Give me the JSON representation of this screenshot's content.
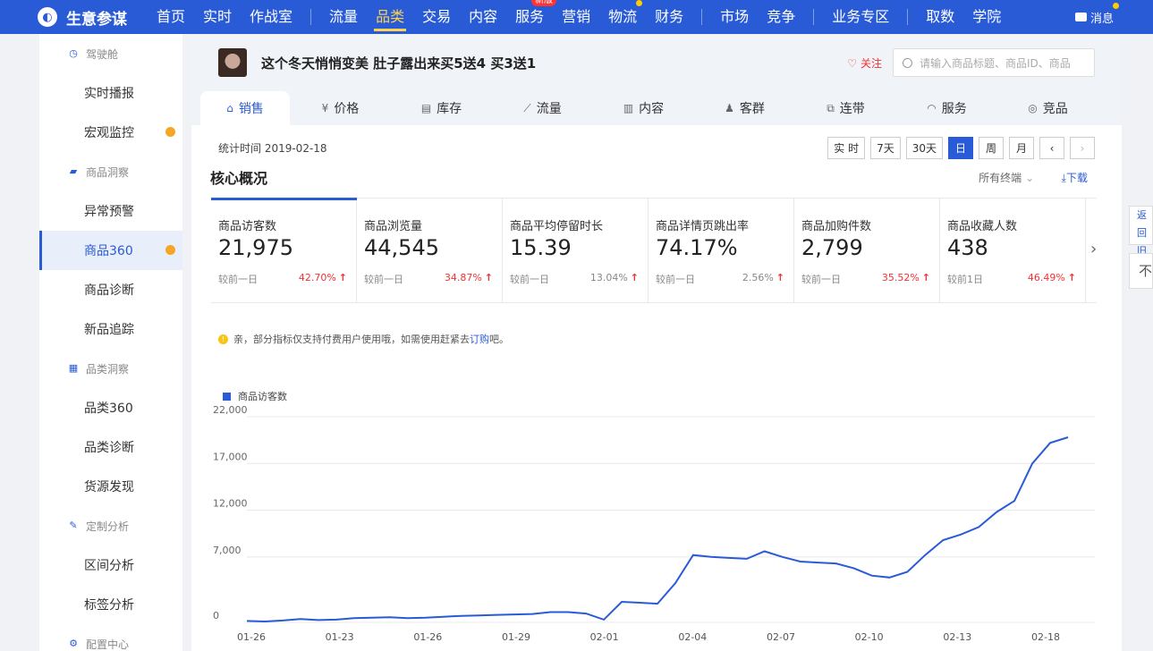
{
  "app": {
    "title": "生意参谋",
    "logo_icon": "compass-icon"
  },
  "nav": {
    "items": [
      {
        "label": "首页"
      },
      {
        "label": "实时"
      },
      {
        "label": "作战室"
      },
      {
        "label": "流量"
      },
      {
        "label": "品类",
        "active": true
      },
      {
        "label": "交易"
      },
      {
        "label": "内容"
      },
      {
        "label": "服务",
        "badge": "新版"
      },
      {
        "label": "营销"
      },
      {
        "label": "物流",
        "dot": true
      },
      {
        "label": "财务"
      },
      {
        "label": "市场"
      },
      {
        "label": "竞争"
      },
      {
        "label": "业务专区"
      },
      {
        "label": "取数"
      },
      {
        "label": "学院"
      }
    ],
    "message_label": "消息"
  },
  "sidebar": {
    "groups": [
      {
        "label": "驾驶舱",
        "icon": "dashboard-icon",
        "items": [
          {
            "label": "实时播报"
          },
          {
            "label": "宏观监控",
            "dot": true
          }
        ]
      },
      {
        "label": "商品洞察",
        "icon": "bag-icon",
        "items": [
          {
            "label": "异常预警"
          },
          {
            "label": "商品360",
            "dot": true,
            "active": true
          },
          {
            "label": "商品诊断"
          },
          {
            "label": "新品追踪"
          }
        ]
      },
      {
        "label": "品类洞察",
        "icon": "grid-icon",
        "items": [
          {
            "label": "品类360"
          },
          {
            "label": "品类诊断"
          },
          {
            "label": "货源发现"
          }
        ]
      },
      {
        "label": "定制分析",
        "icon": "wrench-icon",
        "items": [
          {
            "label": "区间分析"
          },
          {
            "label": "标签分析"
          }
        ]
      },
      {
        "label": "配置中心",
        "icon": "gear-icon",
        "items": []
      }
    ]
  },
  "product": {
    "title": "这个冬天悄悄变美 肚子露出来买5送4 买3送1",
    "follow_label": "关注",
    "search_placeholder": "请输入商品标题、商品ID、商品"
  },
  "tabs": [
    {
      "label": "销售",
      "icon": "house-icon",
      "active": true
    },
    {
      "label": "价格",
      "icon": "yen-icon"
    },
    {
      "label": "库存",
      "icon": "warehouse-icon"
    },
    {
      "label": "流量",
      "icon": "trend-icon"
    },
    {
      "label": "内容",
      "icon": "doc-icon"
    },
    {
      "label": "客群",
      "icon": "users-icon"
    },
    {
      "label": "连带",
      "icon": "link-icon"
    },
    {
      "label": "服务",
      "icon": "headset-icon"
    },
    {
      "label": "竞品",
      "icon": "target-icon"
    }
  ],
  "toolbar": {
    "stat_time": "统计时间 2019-02-18",
    "periods": [
      {
        "label": "实 时"
      },
      {
        "label": "7天"
      },
      {
        "label": "30天"
      },
      {
        "label": "日",
        "active": true
      },
      {
        "label": "周"
      },
      {
        "label": "月"
      },
      {
        "label": "‹"
      },
      {
        "label": "›",
        "dim": true
      }
    ]
  },
  "overview": {
    "title": "核心概况",
    "terminals_label": "所有终端",
    "download_label": "下载",
    "cards": [
      {
        "label": "商品访客数",
        "value": "21,975",
        "cmp": "较前一日",
        "pct": "42.70%",
        "dir": "up",
        "active": true
      },
      {
        "label": "商品浏览量",
        "value": "44,545",
        "cmp": "较前一日",
        "pct": "34.87%",
        "dir": "up"
      },
      {
        "label": "商品平均停留时长",
        "value": "15.39",
        "cmp": "较前一日",
        "pct": "13.04%",
        "dir": "up"
      },
      {
        "label": "商品详情页跳出率",
        "value": "74.17%",
        "cmp": "较前一日",
        "pct": "2.56%",
        "dir": "up"
      },
      {
        "label": "商品加购件数",
        "value": "2,799",
        "cmp": "较前一日",
        "pct": "35.52%",
        "dir": "up"
      },
      {
        "label": "商品收藏人数",
        "value": "438",
        "cmp": "较前1日",
        "pct": "46.49%",
        "dir": "up"
      }
    ]
  },
  "notice": {
    "text": "亲，部分指标仅支持付费用户使用哦，如需使用赶紧去",
    "link": "订购",
    "suffix": "吧。"
  },
  "right_float": {
    "back_label": "返回旧版",
    "no_label": "不"
  },
  "chart_data": {
    "type": "line",
    "series": [
      {
        "name": "商品访客数",
        "color": "#2a5bd7",
        "values": [
          150,
          100,
          200,
          350,
          250,
          300,
          450,
          500,
          550,
          450,
          500,
          600,
          700,
          750,
          800,
          850,
          900,
          1100,
          1100,
          950,
          300,
          2200,
          2100,
          2000,
          4200,
          7200,
          7000,
          6900,
          6800,
          7600,
          7000,
          6500,
          6400,
          6300,
          5800,
          5000,
          4800,
          5400,
          7200,
          8800,
          9400,
          10200,
          11800,
          13000,
          17000,
          19200,
          19800
        ]
      }
    ],
    "x_tick_labels": [
      "01-26",
      "01-23",
      "01-26",
      "01-29",
      "02-01",
      "02-04",
      "02-07",
      "02-10",
      "02-13",
      "02-18"
    ],
    "y_ticks": [
      0,
      7000,
      12000,
      17000,
      22000
    ],
    "y_tick_labels": [
      "0",
      "7,000",
      "12,000",
      "17,000",
      "22,000"
    ],
    "ylim": [
      0,
      22000
    ],
    "grid": true,
    "legend": "top-left"
  }
}
